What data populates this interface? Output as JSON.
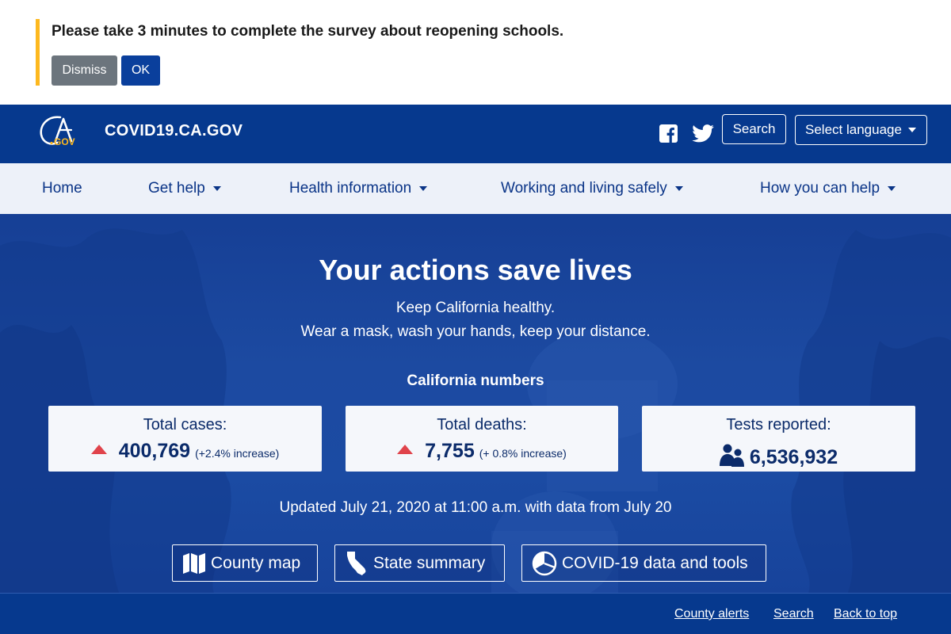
{
  "survey": {
    "message": "Please take 3 minutes to complete the survey about reopening schools.",
    "dismiss_label": "Dismiss",
    "ok_label": "OK",
    "accent_color": "#fdb81e"
  },
  "header": {
    "site_title": "COVID19.CA.GOV",
    "logo_text": "CA.GOV",
    "search_label": "Search",
    "language_label": "Select language",
    "social_icons": [
      "facebook-icon",
      "twitter-icon"
    ],
    "background_color": "#06398e"
  },
  "nav": {
    "items": [
      {
        "label": "Home",
        "dropdown": false
      },
      {
        "label": "Get help",
        "dropdown": true
      },
      {
        "label": "Health information",
        "dropdown": true
      },
      {
        "label": "Working and living safely",
        "dropdown": true
      },
      {
        "label": "How you can help",
        "dropdown": true
      }
    ]
  },
  "hero": {
    "title": "Your actions save lives",
    "line1": "Keep California healthy.",
    "line2": "Wear a mask, wash your hands, keep your distance.",
    "numbers_label": "California numbers",
    "updated": "Updated July 21, 2020 at 11:00 a.m. with data from July 20"
  },
  "stats": [
    {
      "label": "Total cases:",
      "value": "400,769",
      "change": "(+2.4% increase)",
      "icon": "up-triangle-icon"
    },
    {
      "label": "Total deaths:",
      "value": "7,755",
      "change": "(+ 0.8% increase)",
      "icon": "up-triangle-icon"
    },
    {
      "label": "Tests reported:",
      "value": "6,536,932",
      "change": "",
      "icon": "people-icon"
    }
  ],
  "hero_buttons": [
    {
      "label": "County map",
      "icon": "map-icon"
    },
    {
      "label": "State summary",
      "icon": "california-icon"
    },
    {
      "label": "COVID-19 data and tools",
      "icon": "pie-chart-icon"
    }
  ],
  "footer": {
    "links": [
      "County alerts",
      "Search",
      "Back to top"
    ]
  },
  "colors": {
    "primary": "#06398e",
    "alert_red": "#e0434b",
    "nav_bg": "#edf1f9"
  }
}
